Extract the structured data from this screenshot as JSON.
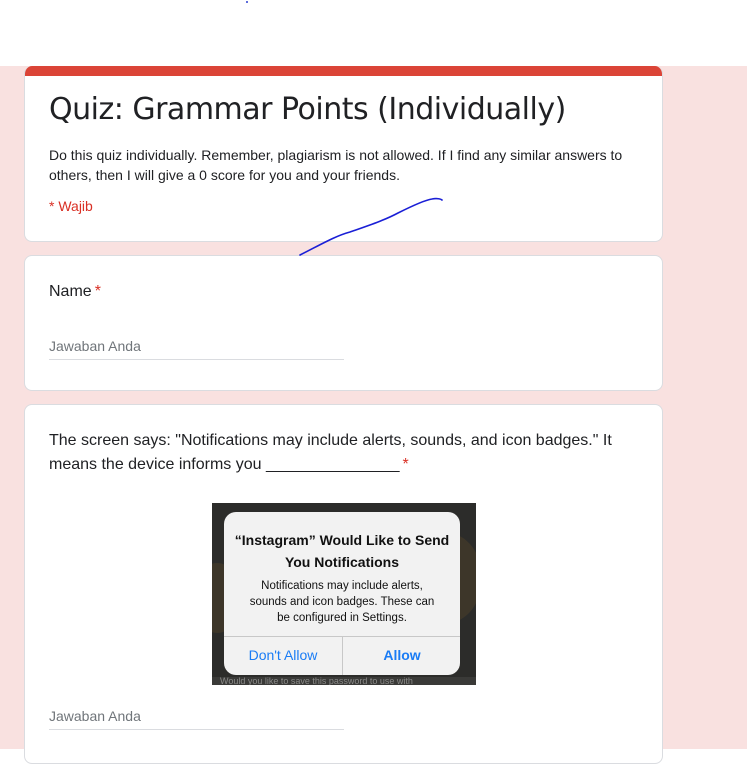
{
  "form": {
    "title": "Quiz: Grammar Points (Individually)",
    "description": "Do this quiz individually. Remember, plagiarism is not allowed. If I find any similar answers to others, then I will give a 0 score for you and your friends.",
    "required_note": "* Wajib",
    "accent_color": "#db4437",
    "background_color": "#f9e1e0"
  },
  "questions": [
    {
      "label": "Name",
      "required_mark": "*",
      "answer_placeholder": "Jawaban Anda"
    },
    {
      "label": "The screen says: \"Notifications may include alerts, sounds, and icon badges.\" It means the device informs you _______________",
      "required_mark": "*",
      "answer_placeholder": "Jawaban Anda",
      "image": {
        "dialog_title": "“Instagram” Would Like to Send You Notifications",
        "dialog_message": "Notifications may include alerts, sounds and icon badges. These can be configured in Settings.",
        "deny_label": "Don't Allow",
        "allow_label": "Allow",
        "bottom_text": "Would you like to save this password to use with"
      }
    }
  ],
  "icons": [
    "pen-annotation-stroke"
  ]
}
